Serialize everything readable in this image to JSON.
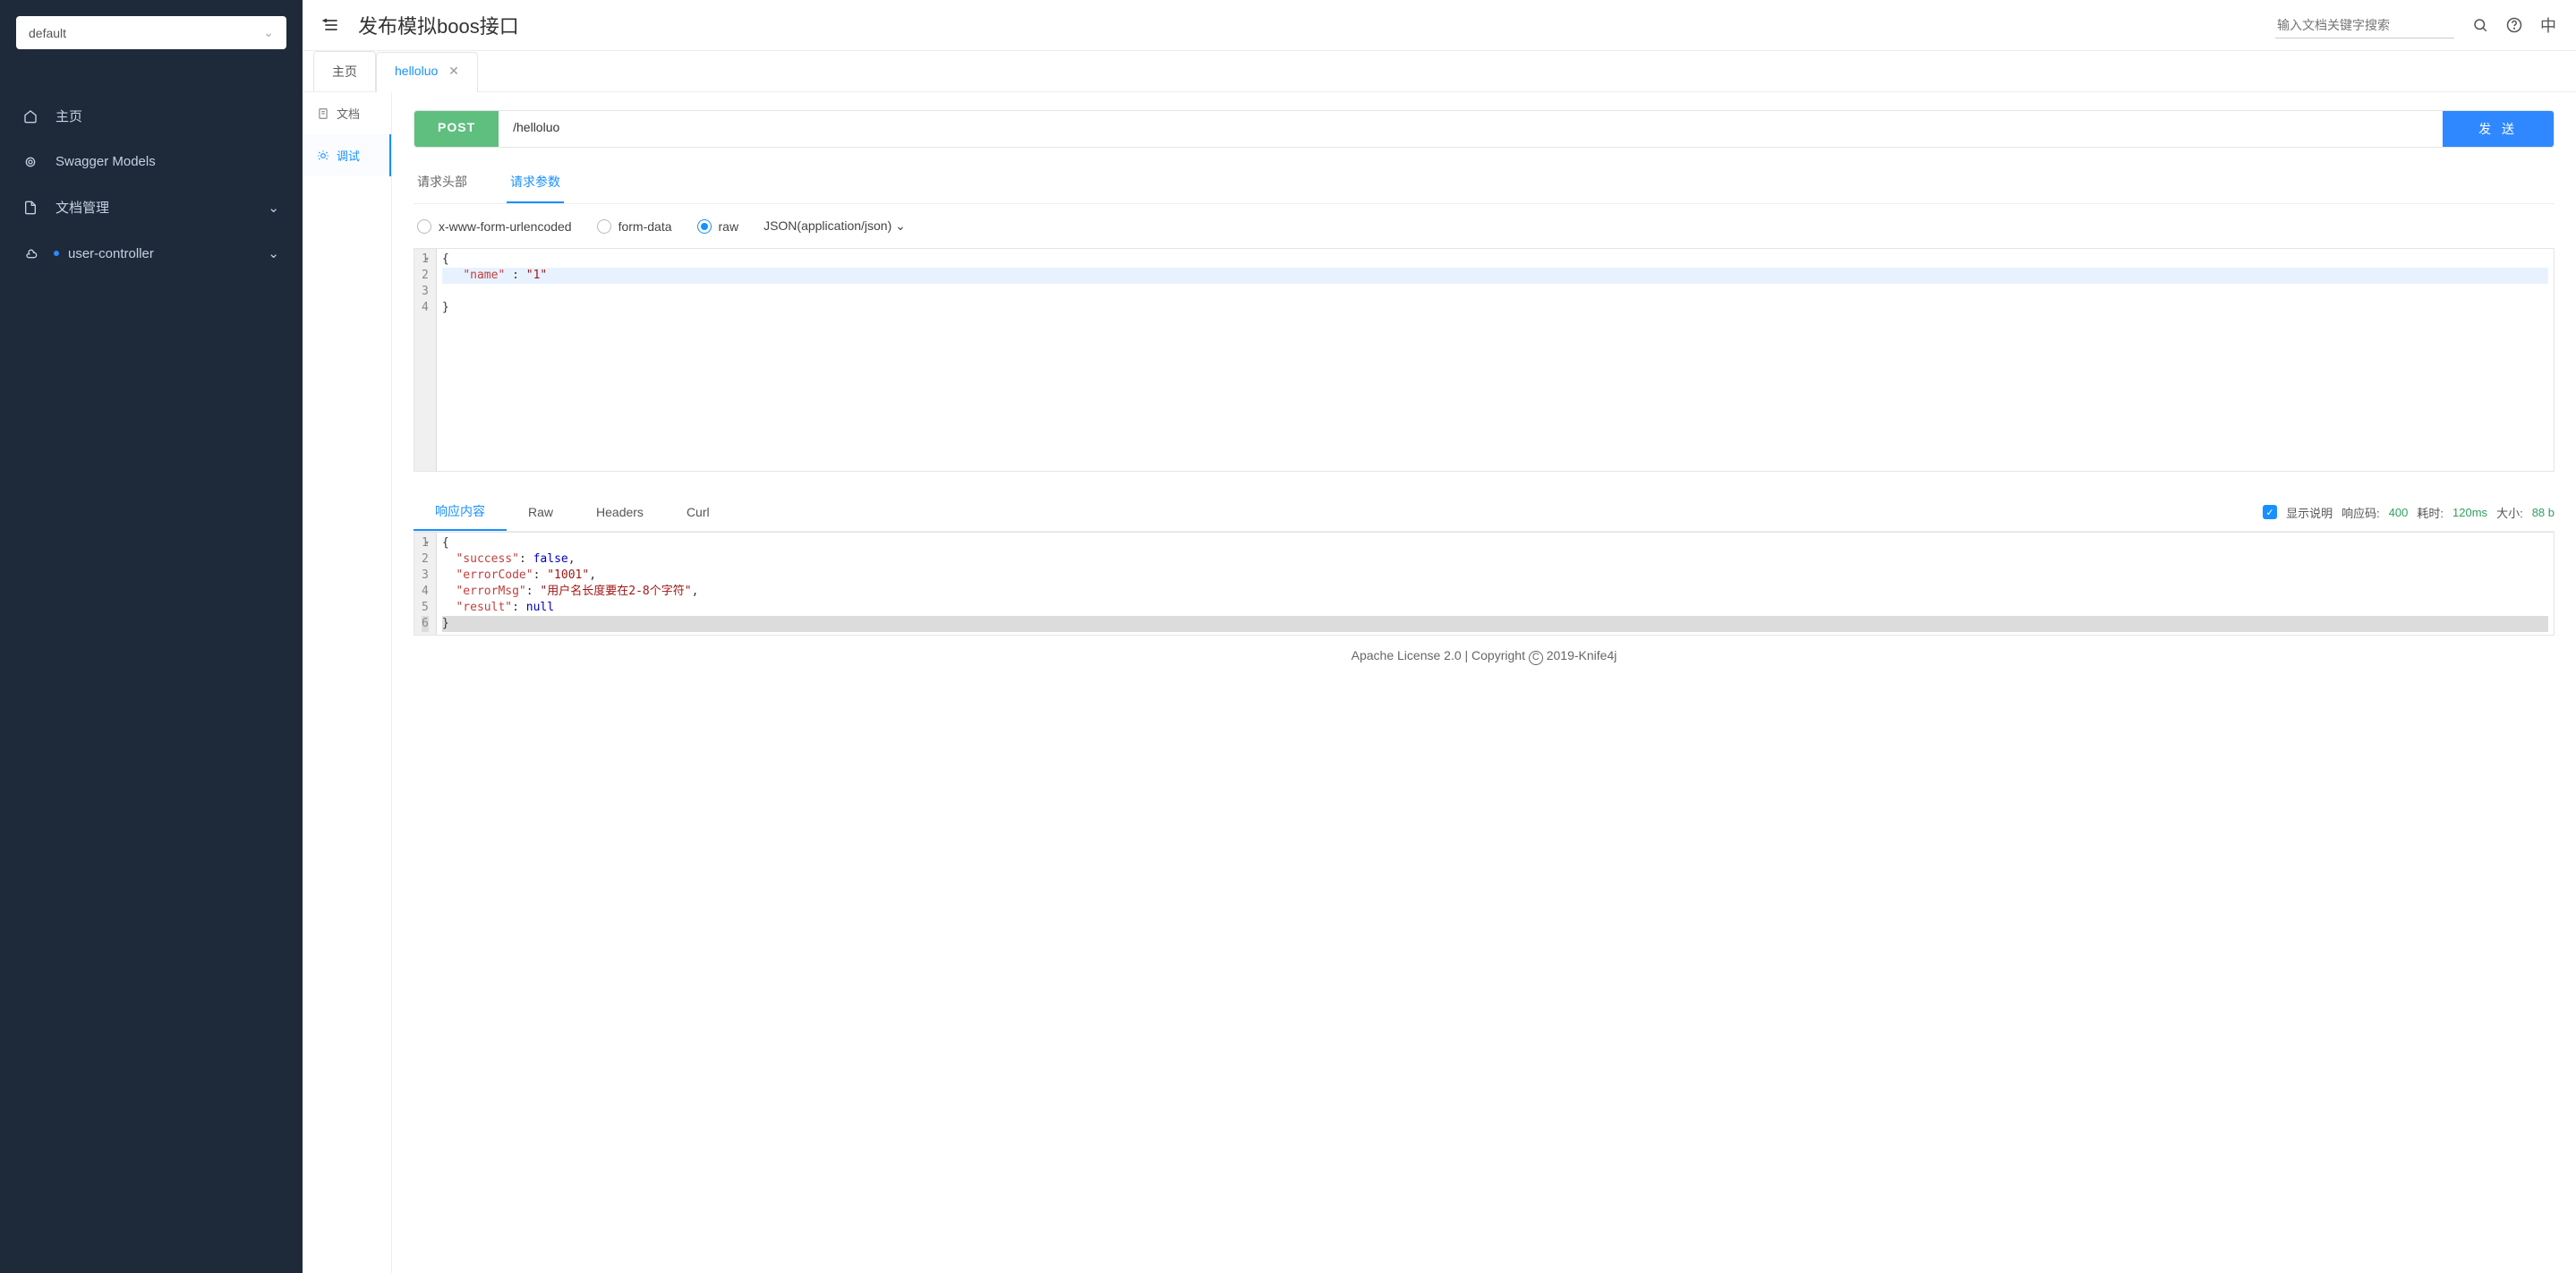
{
  "sidebar": {
    "group": "default",
    "items": [
      {
        "label": "主页",
        "icon": "home"
      },
      {
        "label": "Swagger Models",
        "icon": "models"
      },
      {
        "label": "文档管理",
        "icon": "docs",
        "expandable": true
      },
      {
        "label": "user-controller",
        "icon": "cloud",
        "expandable": true,
        "dot": true
      }
    ]
  },
  "header": {
    "title": "发布模拟boos接口",
    "search_placeholder": "输入文档关键字搜索",
    "lang": "中"
  },
  "tabs": [
    {
      "label": "主页",
      "closable": false,
      "active": false
    },
    {
      "label": "helloluo",
      "closable": true,
      "active": true
    }
  ],
  "rail": [
    {
      "label": "文档",
      "active": false
    },
    {
      "label": "调试",
      "active": true
    }
  ],
  "request": {
    "method": "POST",
    "url": "/helloluo",
    "send_label": "发 送",
    "subtabs": [
      {
        "label": "请求头部",
        "active": false
      },
      {
        "label": "请求参数",
        "active": true
      }
    ],
    "body_types": [
      {
        "label": "x-www-form-urlencoded",
        "active": false
      },
      {
        "label": "form-data",
        "active": false
      },
      {
        "label": "raw",
        "active": true
      }
    ],
    "content_type": "JSON(application/json)",
    "body_lines": [
      "{",
      "   \"name\" : \"1\"",
      "",
      "}"
    ]
  },
  "response": {
    "tabs": [
      {
        "label": "响应内容",
        "active": true
      },
      {
        "label": "Raw",
        "active": false
      },
      {
        "label": "Headers",
        "active": false
      },
      {
        "label": "Curl",
        "active": false
      }
    ],
    "show_desc_label": "显示说明",
    "status_label": "响应码:",
    "status_value": "400",
    "time_label": "耗时:",
    "time_value": "120ms",
    "size_label": "大小:",
    "size_value": "88 b",
    "body_lines": [
      "{",
      "  \"success\": false,",
      "  \"errorCode\": \"1001\",",
      "  \"errorMsg\": \"用户名长度要在2-8个字符\",",
      "  \"result\": null",
      "}"
    ]
  },
  "footer": "Apache License 2.0 | Copyright © 2019-Knife4j"
}
